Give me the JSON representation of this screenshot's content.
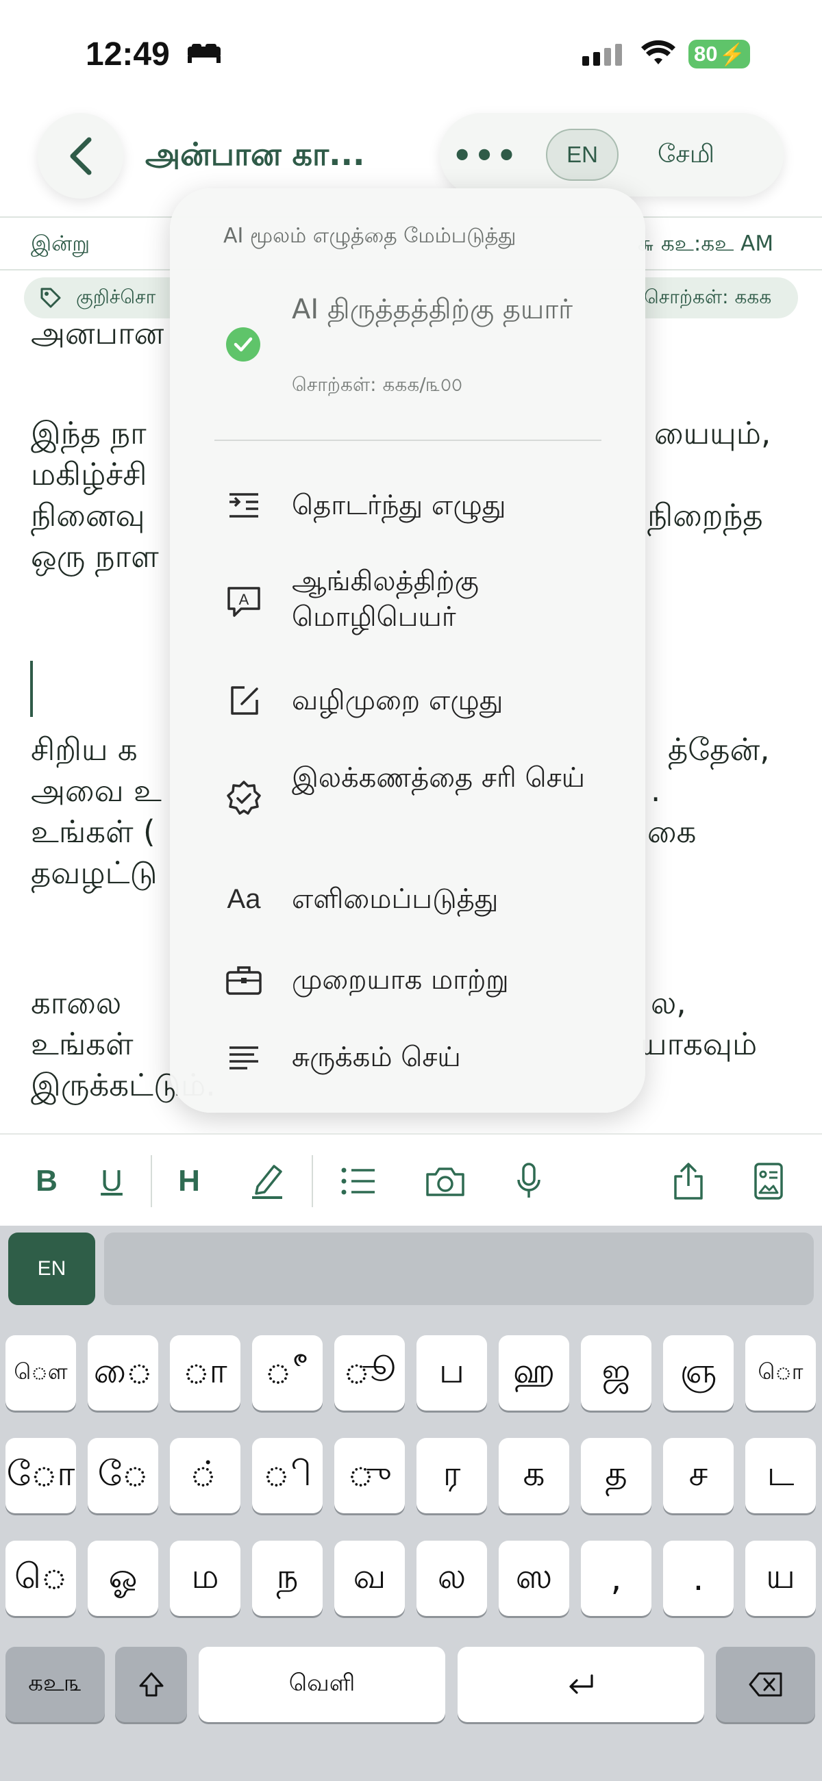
{
  "status_bar": {
    "time": "12:49",
    "battery": "80"
  },
  "header": {
    "title": "அன்பான கா...",
    "more_label": "•••",
    "lang_chip": "EN",
    "save_label": "சேமி"
  },
  "meta": {
    "date_left": "இன்று",
    "date_right": "௬ கஉ:கஉ AM",
    "tag_left": "குறிச்சொ",
    "word_count_right": "சொற்கள்: ககக"
  },
  "editor": {
    "para1_lines": [
      "இந்த நா",
      "மகிழ்ச்சி",
      "நினைவு",
      "ஒரு நாள"
    ],
    "para1_right": [
      "யையும்,",
      "",
      "நிறைந்த",
      ""
    ],
    "para2_lines": [
      "சிறிய க",
      "அவை உ",
      "உங்கள் (",
      "தவழட்டு"
    ],
    "para2_right": [
      "த்தேன்,",
      ".",
      "கை",
      ""
    ],
    "para3_lines": [
      "காலை",
      "உங்கள்",
      "இருக்கட்டும்."
    ],
    "para3_right": [
      "ல,",
      "யாகவும்",
      ""
    ],
    "top_partial": "அன்பான"
  },
  "ai_menu": {
    "header": "AI மூலம் எழுத்தை மேம்படுத்து",
    "status_title": "AI திருத்தத்திற்கு தயார்",
    "status_sub": "சொற்கள்: ககக/௩௦௦",
    "items": [
      {
        "icon": "continue-writing-icon",
        "label": "தொடர்ந்து எழுது"
      },
      {
        "icon": "translate-icon",
        "label": "ஆங்கிலத்திற்கு மொழிபெயர்"
      },
      {
        "icon": "edit-icon",
        "label": "வழிமுறை எழுது"
      },
      {
        "icon": "verified-badge-icon",
        "label": "இலக்கணத்தை சரி செய்"
      },
      {
        "icon": "font-size-icon",
        "label": "எளிமைப்படுத்து",
        "glyph": "Aa"
      },
      {
        "icon": "briefcase-icon",
        "label": "முறையாக மாற்று"
      },
      {
        "icon": "summary-lines-icon",
        "label": "சுருக்கம் செய்"
      }
    ]
  },
  "toolbar": {
    "bold": "B",
    "underline": "U",
    "heading": "H"
  },
  "keyboard": {
    "lang": "EN",
    "row1": [
      "ௌ",
      "ை",
      "ா",
      "ீ",
      "ூ",
      "ப",
      "ஹ",
      "ஜ",
      "ஞ",
      "ொ"
    ],
    "row2": [
      "ோ",
      "ே",
      "்",
      "ி",
      "ு",
      "ர",
      "க",
      "த",
      "ச",
      "ட"
    ],
    "row3": [
      "ெ",
      "ஓ",
      "ம",
      "ந",
      "வ",
      "ல",
      "ஸ",
      ",",
      ".",
      "ய"
    ],
    "numbers_key": "கஉ௩",
    "space_label": "வெளி"
  }
}
